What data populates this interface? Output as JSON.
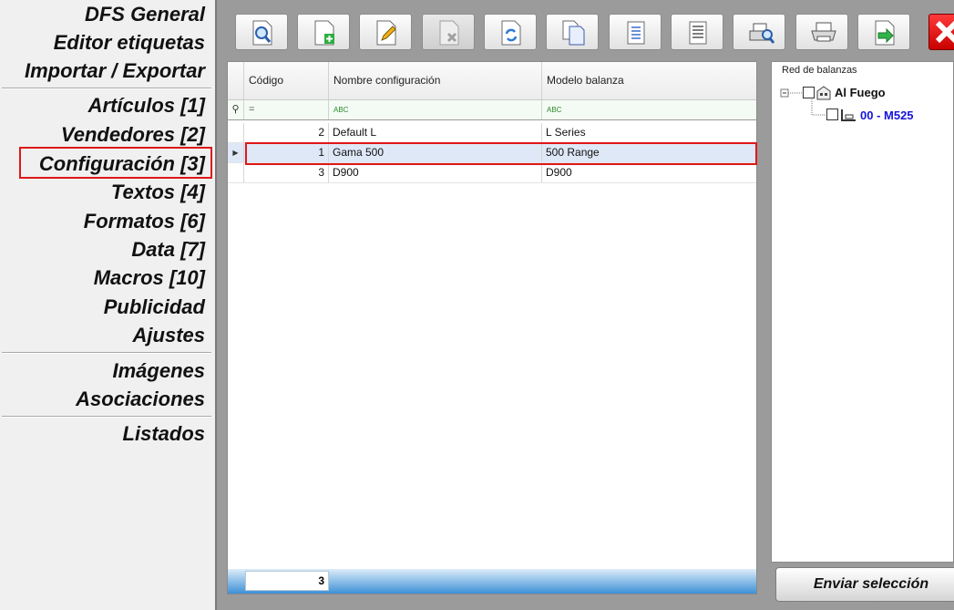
{
  "nav": {
    "items": [
      "DFS General",
      "Editor etiquetas",
      "Importar / Exportar",
      "Artículos [1]",
      "Vendedores [2]",
      "Configuración [3]",
      "Textos [4]",
      "Formatos [6]",
      "Data [7]",
      "Macros [10]",
      "Publicidad",
      "Ajustes",
      "Imágenes",
      "Asociaciones",
      "Listados"
    ],
    "selected": "Configuración [3]"
  },
  "toolbar": {
    "buttons": [
      {
        "name": "preview-button",
        "icon": "magnifier-document-icon",
        "enabled": true
      },
      {
        "name": "new-button",
        "icon": "document-add-icon",
        "enabled": true
      },
      {
        "name": "edit-button",
        "icon": "document-edit-icon",
        "enabled": true
      },
      {
        "name": "delete-button",
        "icon": "document-delete-icon",
        "enabled": false
      },
      {
        "name": "refresh-button",
        "icon": "document-refresh-icon",
        "enabled": true
      },
      {
        "name": "copy-button",
        "icon": "documents-copy-icon",
        "enabled": true
      },
      {
        "name": "list-button",
        "icon": "list-document-icon",
        "enabled": true
      },
      {
        "name": "lines-button",
        "icon": "lines-document-icon",
        "enabled": true
      },
      {
        "name": "search-print-button",
        "icon": "print-preview-icon",
        "enabled": true
      },
      {
        "name": "print-button",
        "icon": "printer-icon",
        "enabled": true
      },
      {
        "name": "export-button",
        "icon": "document-export-icon",
        "enabled": true
      }
    ],
    "close_icon": "close-icon"
  },
  "grid": {
    "columns": [
      "Código",
      "Nombre configuración",
      "Modelo balanza"
    ],
    "filter_symbols": [
      "=",
      "ABC",
      "ABC"
    ],
    "rows": [
      {
        "codigo": "2",
        "nombre": "Default L",
        "modelo": "L Series",
        "selected": false
      },
      {
        "codigo": "1",
        "nombre": "Gama 500",
        "modelo": "500 Range",
        "selected": true
      },
      {
        "codigo": "3",
        "nombre": "D900",
        "modelo": "D900",
        "selected": false
      }
    ],
    "footer_count": "3",
    "accent_color": "#3e90d6",
    "highlight_color": "#e01818"
  },
  "tree": {
    "title": "Red de balanzas",
    "root": "Al Fuego",
    "child": "00 - M525",
    "child_color": "#1414d8"
  },
  "send_button": "Enviar selección"
}
